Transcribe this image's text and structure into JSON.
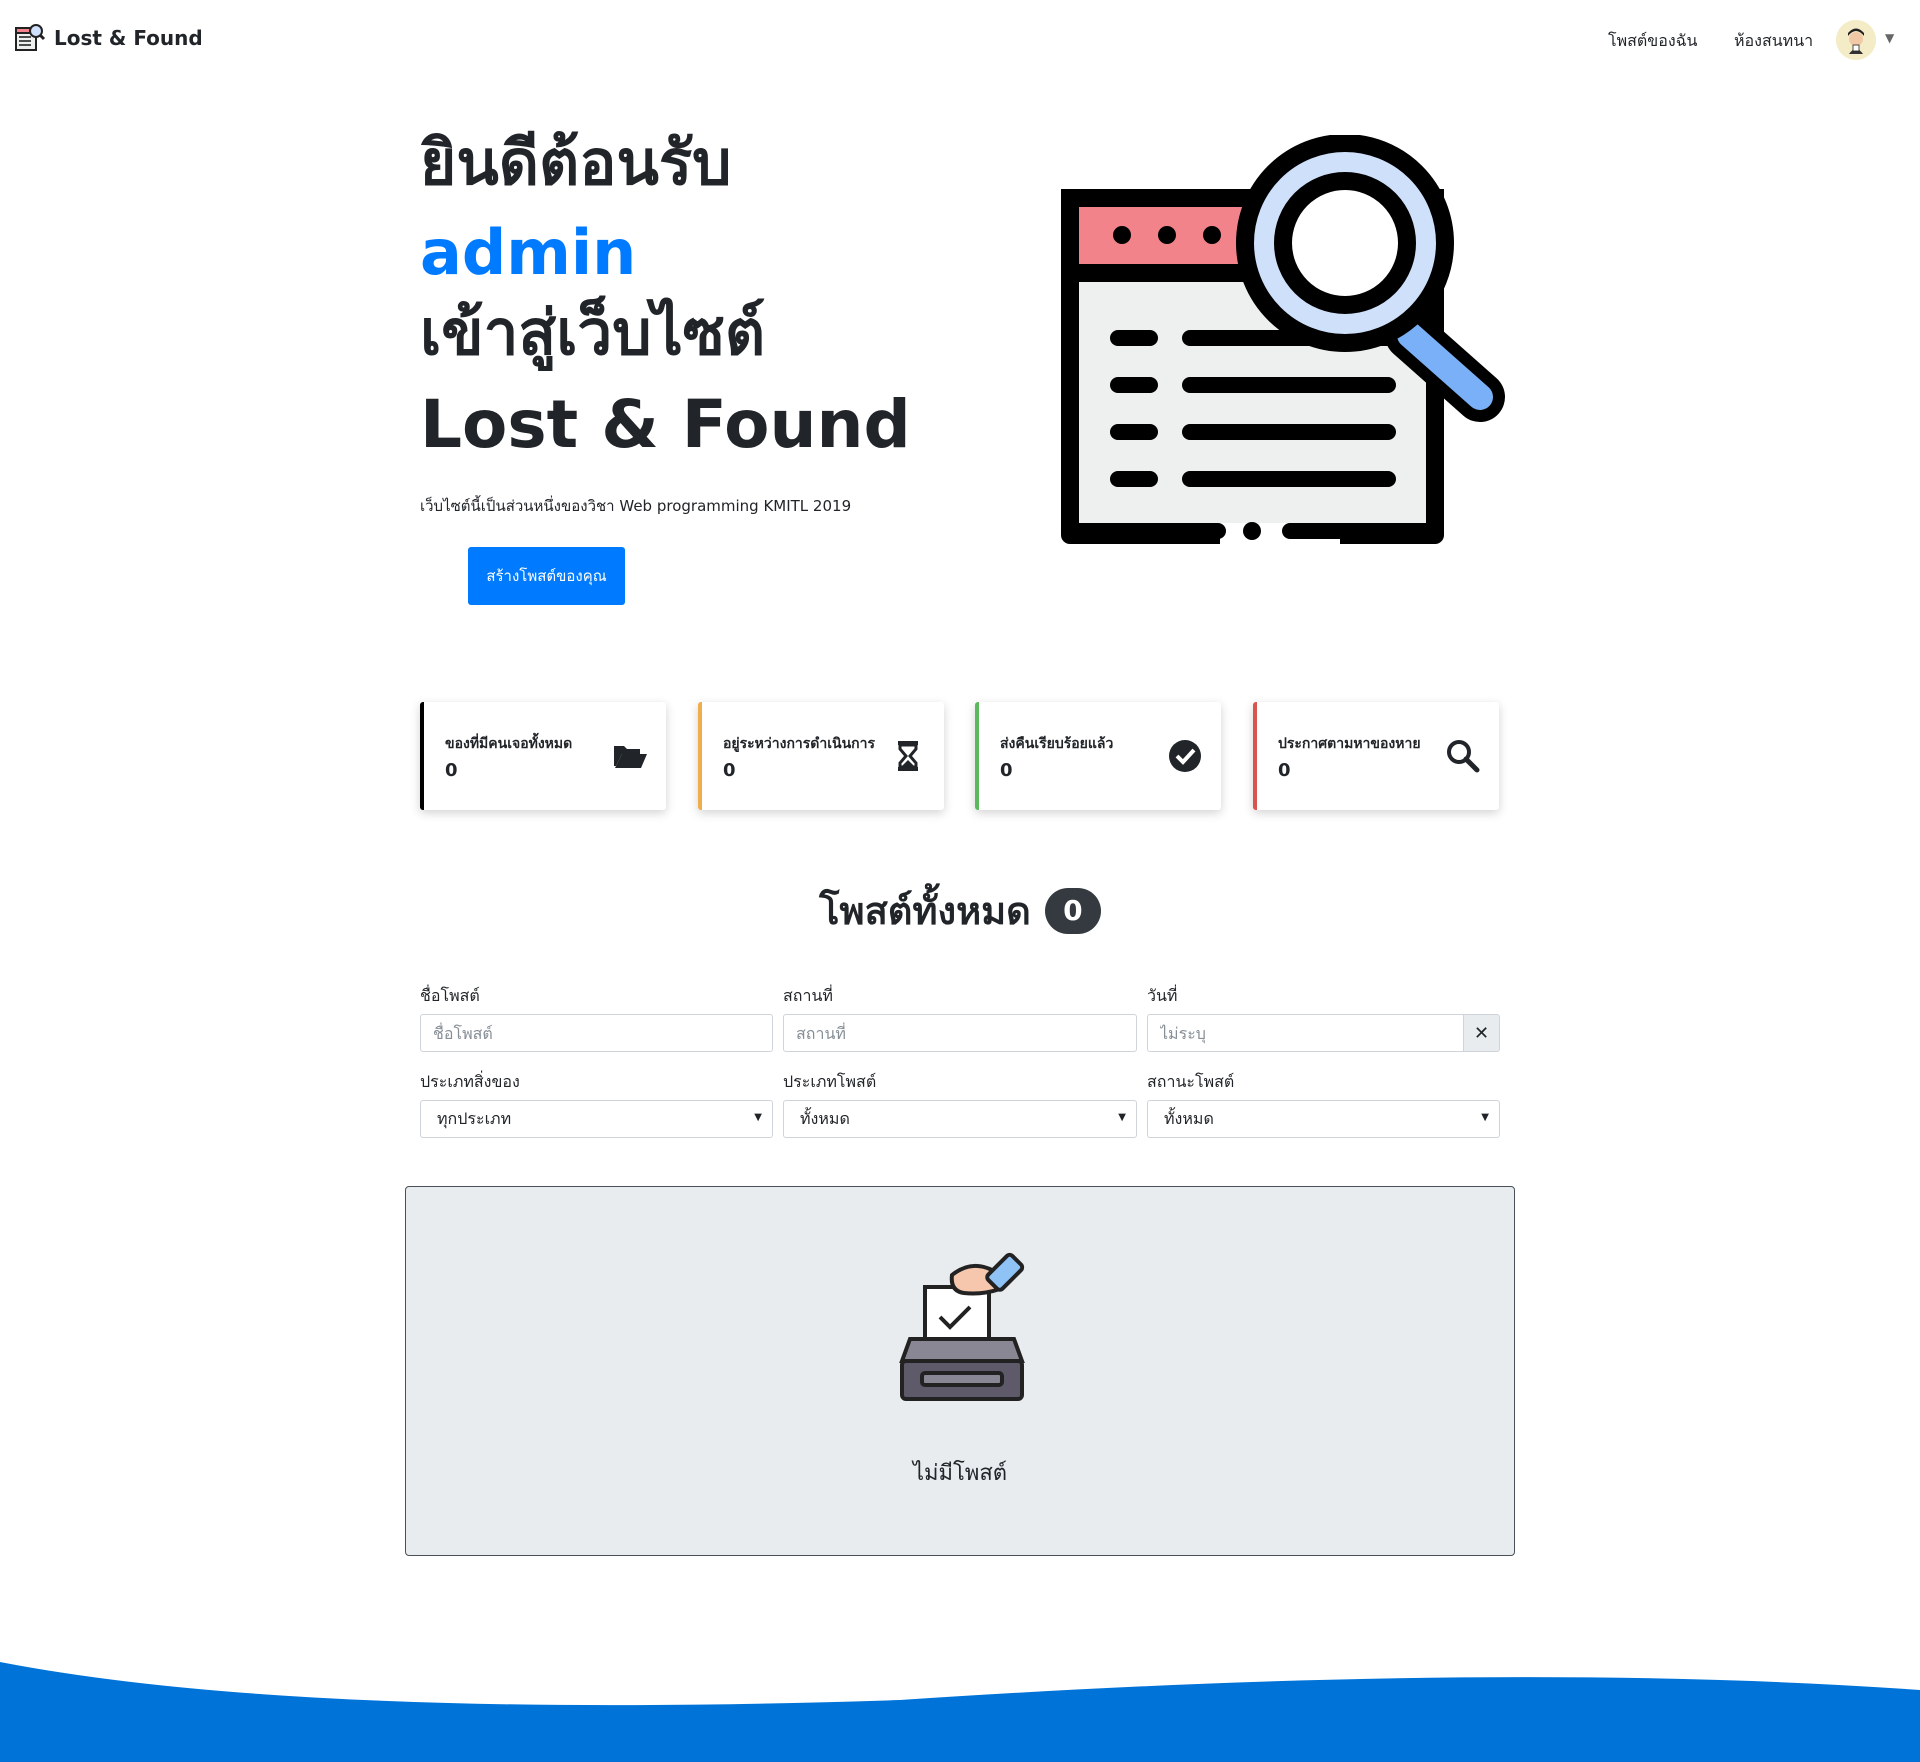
{
  "navbar": {
    "brand": "Lost & Found",
    "links": [
      "โพสต์ของฉัน",
      "ห้องสนทนา"
    ],
    "avatar_icon": "user-avatar",
    "caret_icon": "caret-down-icon"
  },
  "hero": {
    "line1": "ยินดีต้อนรับ",
    "username": "admin",
    "line3": "เข้าสู่เว็บไซต์",
    "line4": "Lost & Found",
    "subtitle": "เว็บไซต์นี้เป็นส่วนหนึ่งของวิชา Web programming KMITL 2019",
    "cta": "สร้างโพสต์ของคุณ",
    "illustration_icon": "search-document-icon"
  },
  "stats": [
    {
      "label": "ของที่มีคนเจอทั้งหมด",
      "value": "0",
      "icon": "folder-open-icon",
      "accent": "#000000"
    },
    {
      "label": "อยู่ระหว่างการดำเนินการ",
      "value": "0",
      "icon": "hourglass-icon",
      "accent": "#f0ad4e"
    },
    {
      "label": "ส่งคืนเรียบร้อยแล้ว",
      "value": "0",
      "icon": "check-circle-icon",
      "accent": "#5cb85c"
    },
    {
      "label": "ประกาศตามหาของหาย",
      "value": "0",
      "icon": "search-icon",
      "accent": "#d9534f"
    }
  ],
  "posts": {
    "title": "โพสต์ทั้งหมด",
    "count": "0"
  },
  "filters": {
    "name_label": "ชื่อโพสต์",
    "name_placeholder": "ชื่อโพสต์",
    "place_label": "สถานที่",
    "place_placeholder": "สถานที่",
    "date_label": "วันที่",
    "date_placeholder": "ไม่ระบุ",
    "clear": "✕",
    "item_type_label": "ประเภทสิ่งของ",
    "item_type_value": "ทุกประเภท",
    "post_type_label": "ประเภทโพสต์",
    "post_type_value": "ทั้งหมด",
    "status_label": "สถานะโพสต์",
    "status_value": "ทั้งหมด"
  },
  "empty": {
    "text": "ไม่มีโพสต์",
    "icon": "ballot-box-icon"
  },
  "colors": {
    "primary": "#007bff",
    "wave": "#0073d9",
    "panel_bg": "#e9ecef"
  }
}
